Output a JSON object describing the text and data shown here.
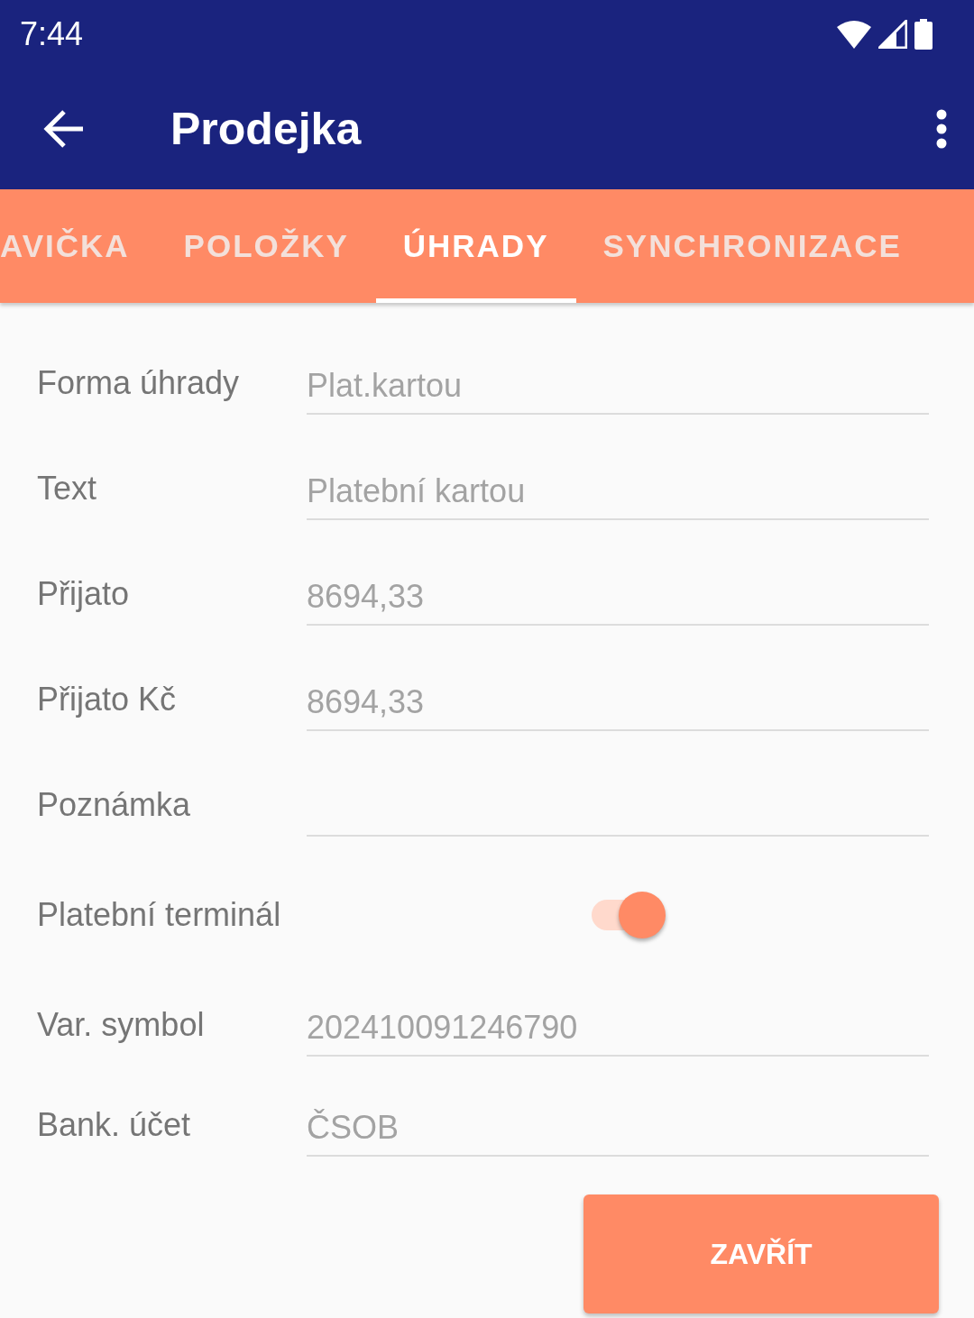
{
  "status_bar": {
    "time": "7:44"
  },
  "app_bar": {
    "title": "Prodejka"
  },
  "tabs": [
    {
      "label": "AVIČKA",
      "selected": false
    },
    {
      "label": "POLOŽKY",
      "selected": false
    },
    {
      "label": "ÚHRADY",
      "selected": true
    },
    {
      "label": "SYNCHRONIZACE",
      "selected": false
    }
  ],
  "form": [
    {
      "kind": "text",
      "label": "Forma úhrady",
      "value": "Plat.kartou"
    },
    {
      "kind": "text",
      "label": "Text",
      "value": "Platební kartou"
    },
    {
      "kind": "text",
      "label": "Přijato",
      "value": "8694,33"
    },
    {
      "kind": "text",
      "label": "Přijato Kč",
      "value": "8694,33"
    },
    {
      "kind": "text",
      "label": "Poznámka"
    },
    {
      "kind": "switch",
      "label": "Platební terminál",
      "on": true
    },
    {
      "kind": "text",
      "label": "Var. symbol",
      "value": "202410091246790"
    },
    {
      "kind": "text",
      "label": "Bank. účet",
      "value": "ČSOB"
    }
  ],
  "buttons": [
    {
      "label": "ZAVŘÍT"
    }
  ]
}
